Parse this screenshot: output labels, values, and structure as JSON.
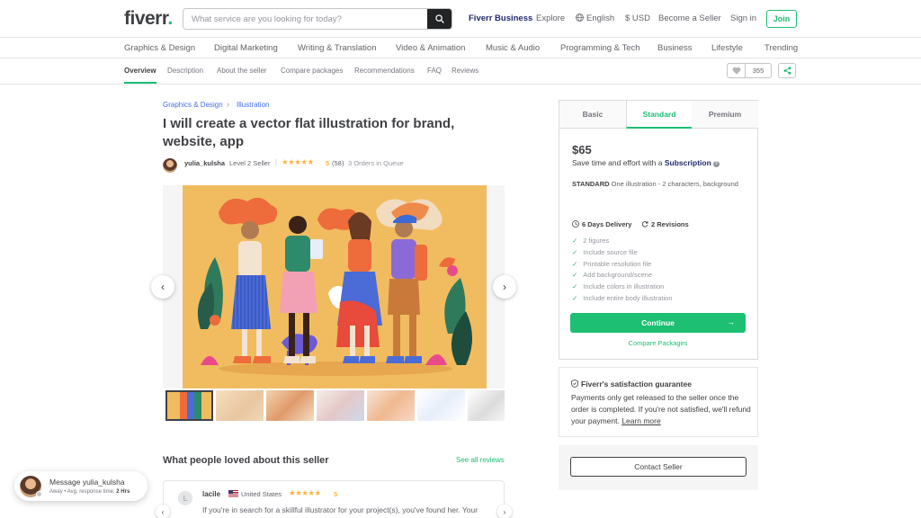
{
  "header": {
    "logo": "fiverr",
    "logo_dot": ".",
    "search_placeholder": "What service are you looking for today?",
    "nav": {
      "business": "Fiverr Business",
      "explore": "Explore",
      "language": "English",
      "currency": "$ USD",
      "become_seller": "Become a Seller",
      "sign_in": "Sign in",
      "join": "Join"
    }
  },
  "categories": [
    "Graphics & Design",
    "Digital Marketing",
    "Writing & Translation",
    "Video & Animation",
    "Music & Audio",
    "Programming & Tech",
    "Business",
    "Lifestyle",
    "Trending"
  ],
  "subnav": {
    "items": [
      "Overview",
      "Description",
      "About the seller",
      "Compare packages",
      "Recommendations",
      "FAQ",
      "Reviews"
    ],
    "active": "Overview",
    "favorites_count": "355"
  },
  "breadcrumb": [
    "Graphics & Design",
    "Illustration"
  ],
  "gig": {
    "title": "I will create a vector flat illustration for brand, website, app",
    "seller": "yulia_kulsha",
    "level": "Level 2 Seller",
    "stars": "★★★★★",
    "rating": "5",
    "rating_count": "(58)",
    "queue": "3 Orders in Queue"
  },
  "reviews": {
    "heading": "What people loved about this seller",
    "see_all": "See all reviews",
    "first": {
      "initial": "L",
      "name": "lacile",
      "country": "United States",
      "stars": "★★★★★",
      "score": "5",
      "text": "If you're in search for a skillful illustrator for your project(s), you've found her. Your vision - Her mission. Her characters - whether it be a person (e.g. a girl"
    }
  },
  "package": {
    "tabs": [
      "Basic",
      "Standard",
      "Premium"
    ],
    "active_tab": "Standard",
    "price": "$65",
    "subscription_prefix": "Save time and effort with a",
    "subscription_link": "Subscription",
    "desc_label": "STANDARD",
    "desc_text": "One illustration - 2 characters, background",
    "delivery": "6 Days Delivery",
    "revisions": "2 Revisions",
    "features": [
      "2 figures",
      "Include source file",
      "Printable resolution file",
      "Add background/scene",
      "Include colors in illustration",
      "Include entire body illustration"
    ],
    "continue": "Continue",
    "compare": "Compare Packages"
  },
  "guarantee": {
    "title": "Fiverr's satisfaction guarantee",
    "text": "Payments only get released to the seller once the order is completed. If you're not satisfied, we'll refund your payment.",
    "learn_more": "Learn more"
  },
  "contact": "Contact Seller",
  "chat": {
    "title": "Message yulia_kulsha",
    "status": "Away",
    "response_label": "Avg. response time:",
    "response_value": "2 Hrs"
  },
  "colors": {
    "brand_green": "#1dbf73",
    "text_dark": "#404145",
    "link_blue": "#446ee7",
    "star": "#ffb33e",
    "art_bg": "#f1bc60"
  }
}
